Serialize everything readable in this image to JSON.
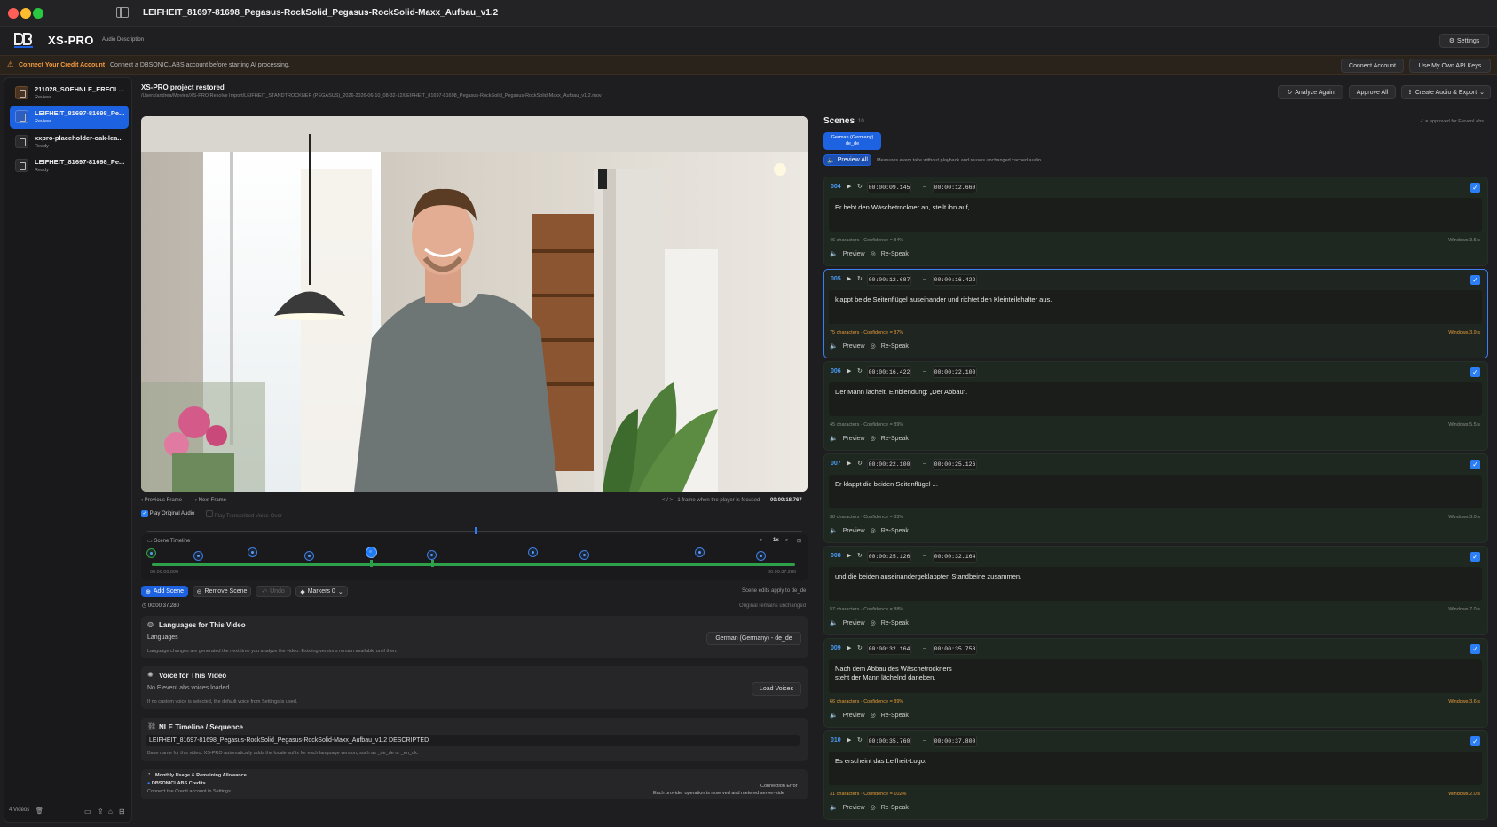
{
  "window": {
    "title": "LEIFHEIT_81697-81698_Pegasus-RockSolid_Pegasus-RockSolid-Maxx_Aufbau_v1.2"
  },
  "app": {
    "name": "XS-PRO",
    "subtitle": "Audio Description",
    "settings_label": "Settings",
    "logo_text": "DBSONICLABS"
  },
  "warning": {
    "title": "Connect Your Credit Account",
    "text": "Connect a DBSONICLABS account before starting AI processing.",
    "connect_label": "Connect Account",
    "api_label": "Use My Own API Keys"
  },
  "sidebar": {
    "items": [
      {
        "name": "211028_SOEHNLE_ERFOL...",
        "status": "Review"
      },
      {
        "name": "LEIFHEIT_81697-81698_Pe...",
        "status": "Review"
      },
      {
        "name": "xxpro-placeholder-oak-lea...",
        "status": "Ready"
      },
      {
        "name": "LEIFHEIT_81697-81698_Pe...",
        "status": "Ready"
      }
    ],
    "footer": "4 Videos"
  },
  "project": {
    "title": "XS-PRO project restored",
    "path": "/Users/andrea/Movies/XS-PRO Resolve Import/LEIFHEIT_STANDTROCKNER (PEGASUS)_2026-2026-06-10_08-32-12/LEIFHEIT_81697-81698_Pegasus-RockSolid_Pegasus-RockSolid-Maxx_Aufbau_v1.2.mov",
    "analyze_label": "Analyze Again",
    "approve_label": "Approve All",
    "export_label": "Create Audio & Export"
  },
  "player": {
    "prev_label": "Previous Frame",
    "next_label": "Next Frame",
    "hint": "< / > - 1 frame when the player is focused",
    "time": "00:00:18.767",
    "play_original": "Play Original Audio",
    "play_voice": "Play Transcribed Voice-Over"
  },
  "timeline": {
    "title": "Scene Timeline",
    "speed": "1x",
    "start": "00:00:00.000",
    "end": "00:00:37.280"
  },
  "scene_tools": {
    "add": "Add Scene",
    "remove": "Remove Scene",
    "undo": "Undo",
    "markers": "Markers 0",
    "note": "Scene edits apply to de_de",
    "note2": "Original remains unchanged",
    "time": "00:00:37.280"
  },
  "languages": {
    "title": "Languages for This Video",
    "label": "Languages",
    "value": "German (Germany) - de_de",
    "help": "Language changes are generated the next time you analyze the video. Existing versions remain available until then."
  },
  "voice": {
    "title": "Voice for This Video",
    "status": "No ElevenLabs voices loaded",
    "load_label": "Load Voices",
    "help": "If no custom voice is selected, the default voice from Settings is used."
  },
  "nle": {
    "title": "NLE Timeline / Sequence",
    "value": "LEIFHEIT_81697-81698_Pegasus-RockSolid_Pegasus-RockSolid-Maxx_Aufbau_v1.2 DESCRIPTED",
    "help": "Base name for this video. XS-PRO automatically adds the locale suffix for each language version, such as _de_de or _en_uk."
  },
  "usage": {
    "title": "Monthly Usage & Remaining Allowance",
    "credits": "DBSONICLABS Credits",
    "connect_hint": "Connect the Credit account in Settings",
    "error": "Connection Error",
    "error_detail": "Each provider operation is reserved and metered server-side"
  },
  "scenes": {
    "title": "Scenes",
    "count": "10",
    "approved_hint": "✓ = approved for ElevenLabs",
    "lang_chip": "German (Germany)\nde_de",
    "preview_all": "Preview All",
    "preview_hint": "Measures every take without playback and reuses unchanged cached audio.",
    "preview_label": "Preview",
    "respeak_label": "Re-Speak",
    "items": [
      {
        "num": "004",
        "start": "00:00:09.145",
        "end": "00:00:12.660",
        "text": "Er hebt den Wäschetrockner an, stellt ihn auf,",
        "meta": "46 characters · Confidence = 84%",
        "window": "Windows 3.5 s",
        "warn": false
      },
      {
        "num": "005",
        "start": "00:00:12.687",
        "end": "00:00:16.422",
        "text": "klappt beide Seitenflügel auseinander und richtet den Kleinteilehalter aus.",
        "meta": "75 characters · Confidence = 87%",
        "window": "Windows 3.9 s",
        "warn": true
      },
      {
        "num": "006",
        "start": "00:00:16.422",
        "end": "00:00:22.100",
        "text": "Der Mann lächelt. Einblendung: „Der Abbau“.",
        "meta": "45 characters · Confidence = 89%",
        "window": "Windows 5.5 s",
        "warn": false
      },
      {
        "num": "007",
        "start": "00:00:22.100",
        "end": "00:00:25.126",
        "text": "Er klappt die beiden Seitenflügel ...",
        "meta": "38 characters · Confidence = 83%",
        "window": "Windows 3.0 s",
        "warn": false
      },
      {
        "num": "008",
        "start": "00:00:25.126",
        "end": "00:00:32.164",
        "text": "und die beiden auseinandergeklappten Standbeine zusammen.",
        "meta": "57 characters · Confidence = 88%",
        "window": "Windows 7.0 s",
        "warn": false
      },
      {
        "num": "009",
        "start": "00:00:32.164",
        "end": "00:00:35.758",
        "text": "Nach dem Abbau des Wäschetrockners\nsteht der Mann lächelnd daneben.",
        "meta": "66 characters · Confidence = 89%",
        "window": "Windows 3.6 s",
        "warn": true
      },
      {
        "num": "010",
        "start": "00:00:35.760",
        "end": "00:00:37.800",
        "text": "Es erscheint das Leifheit-Logo.",
        "meta": "31 characters · Confidence = 102%",
        "window": "Windows 2.0 s",
        "warn": true
      }
    ]
  },
  "colors": {
    "accent": "#1d62e0",
    "warning": "#f39a3e",
    "success": "#2fa04a"
  }
}
